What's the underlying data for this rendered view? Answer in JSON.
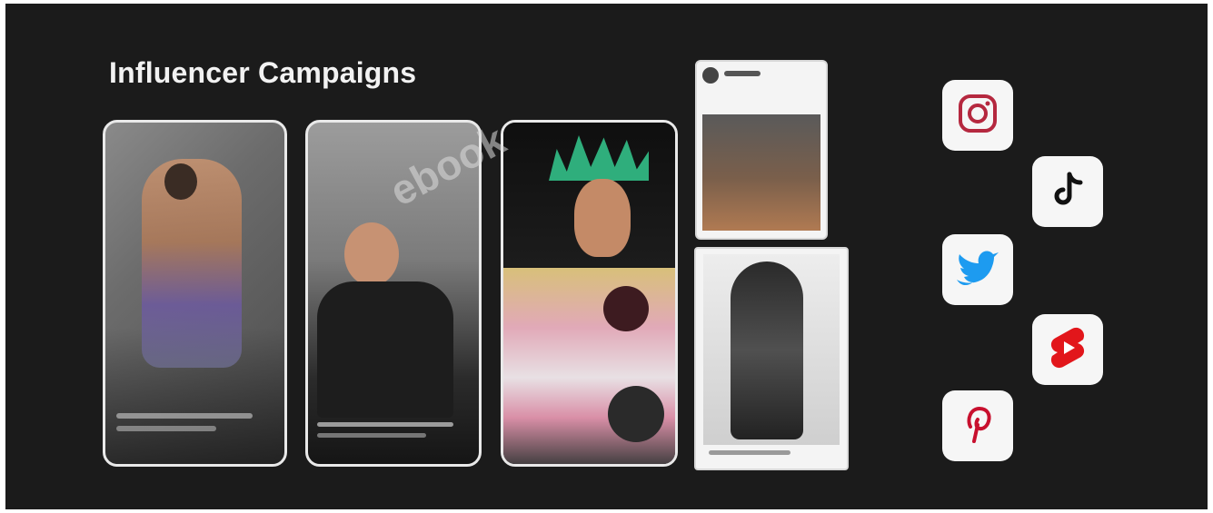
{
  "page": {
    "title": "Influencer Campaigns"
  },
  "colors": {
    "background": "#1b1b1b",
    "title_text": "#f2f2f2",
    "instagram": "#b5283f",
    "tiktok": "#111111",
    "twitter": "#1d9bf0",
    "youtube_shorts": "#e2161b",
    "pinterest": "#c8102e"
  },
  "social_icons": [
    {
      "name": "instagram-icon"
    },
    {
      "name": "tiktok-icon"
    },
    {
      "name": "twitter-icon"
    },
    {
      "name": "youtube-shorts-icon"
    },
    {
      "name": "pinterest-icon"
    }
  ]
}
